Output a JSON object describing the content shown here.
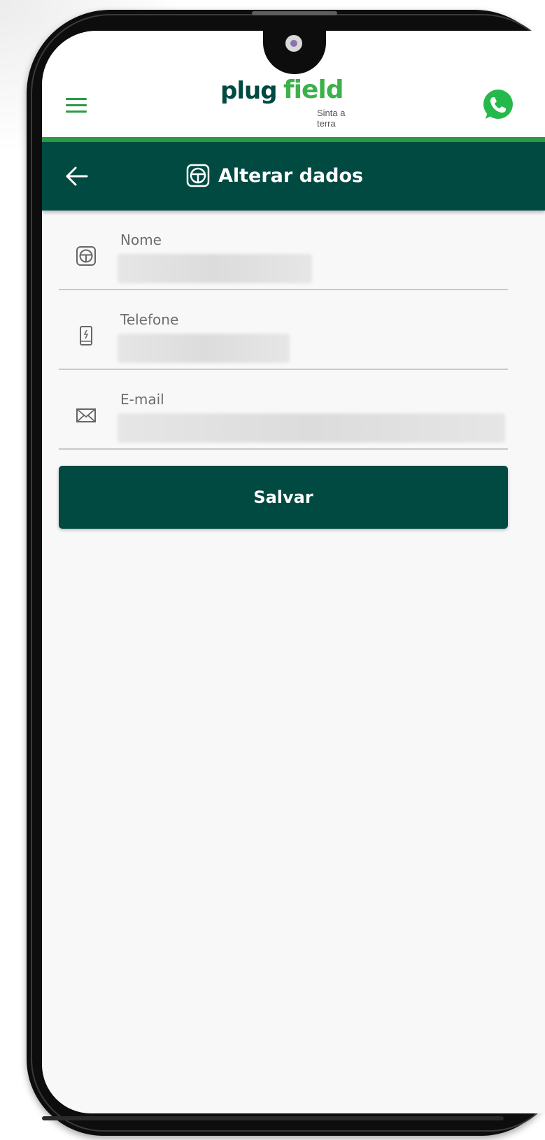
{
  "header": {
    "logo_primary": "plug",
    "logo_secondary": "field",
    "logo_tagline": "Sinta a terra"
  },
  "toolbar": {
    "title": "Alterar dados"
  },
  "form": {
    "fields": [
      {
        "label": "Nome",
        "value": "",
        "icon": "user-driver-icon"
      },
      {
        "label": "Telefone",
        "value": "",
        "icon": "phone-icon"
      },
      {
        "label": "E-mail",
        "value": "",
        "icon": "envelope-icon"
      }
    ],
    "submit_label": "Salvar"
  },
  "colors": {
    "primary_dark": "#004a42",
    "accent_green": "#2b9a45",
    "whatsapp_green": "#25b84a",
    "background": "#f8f8f8"
  }
}
